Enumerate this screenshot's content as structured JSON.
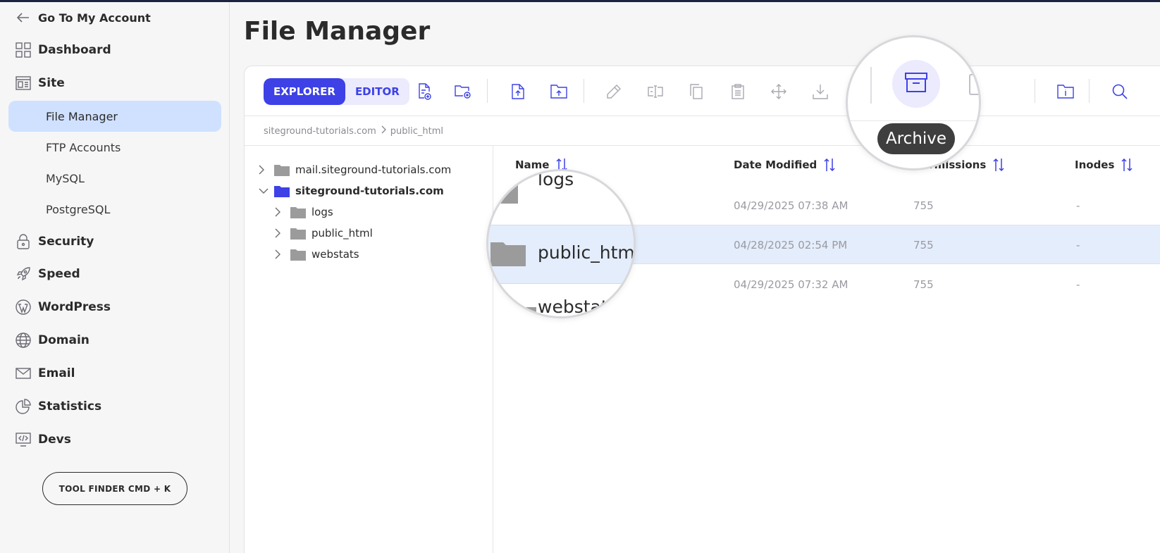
{
  "sidebar": {
    "back": "Go To My Account",
    "items": [
      {
        "label": "Dashboard",
        "icon": "dashboard-icon"
      },
      {
        "label": "Site",
        "icon": "site-icon"
      },
      {
        "label": "Security",
        "icon": "lock-icon"
      },
      {
        "label": "Speed",
        "icon": "rocket-icon"
      },
      {
        "label": "WordPress",
        "icon": "wordpress-icon"
      },
      {
        "label": "Domain",
        "icon": "globe-icon"
      },
      {
        "label": "Email",
        "icon": "mail-icon"
      },
      {
        "label": "Statistics",
        "icon": "pie-chart-icon"
      },
      {
        "label": "Devs",
        "icon": "code-icon"
      }
    ],
    "site_sub": [
      "File Manager",
      "FTP Accounts",
      "MySQL",
      "PostgreSQL"
    ],
    "tool_finder": "TOOL FINDER CMD + K"
  },
  "page": {
    "title": "File Manager"
  },
  "toolbar": {
    "explorer": "EXPLORER",
    "editor": "EDITOR",
    "tooltip": "Archive"
  },
  "breadcrumb": {
    "domain": "siteground-tutorials.com",
    "folder": "public_html"
  },
  "tree": {
    "roots": [
      "mail.siteground-tutorials.com",
      "siteground-tutorials.com"
    ],
    "children": [
      "logs",
      "public_html",
      "webstats"
    ]
  },
  "table": {
    "headers": {
      "name": "Name",
      "date": "Date Modified",
      "perms": "Permissions",
      "inodes": "Inodes"
    },
    "rows": [
      {
        "name": "logs",
        "date": "04/29/2025 07:38 AM",
        "perms": "755",
        "inodes": "-"
      },
      {
        "name": "public_html",
        "date": "04/28/2025 02:54 PM",
        "perms": "755",
        "inodes": "-"
      },
      {
        "name": "webstats",
        "date": "04/29/2025 07:32 AM",
        "perms": "755",
        "inodes": "-"
      }
    ]
  },
  "colors": {
    "accent": "#3d41e6",
    "selected_row": "#e4edfb",
    "active_nav": "#cfe1ff"
  }
}
